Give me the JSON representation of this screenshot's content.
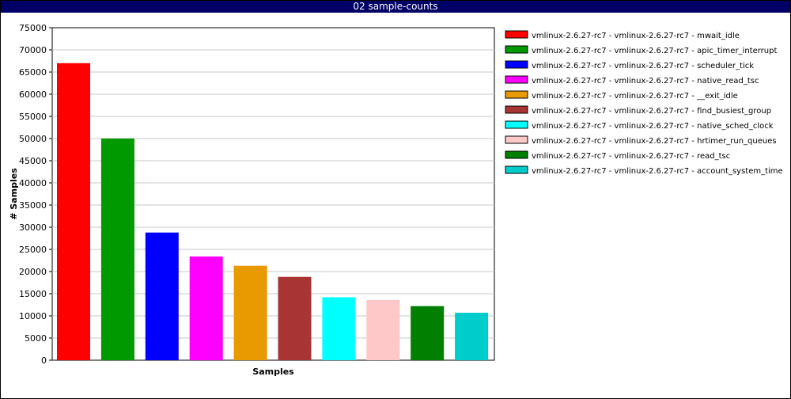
{
  "window": {
    "title": "02 sample-counts"
  },
  "chart_data": {
    "type": "bar",
    "xlabel": "Samples",
    "ylabel": "# Samples",
    "ylim": [
      0,
      75000
    ],
    "yticks": [
      0,
      5000,
      10000,
      15000,
      20000,
      25000,
      30000,
      35000,
      40000,
      45000,
      50000,
      55000,
      60000,
      65000,
      70000,
      75000
    ],
    "grid": true,
    "legend_position": "right",
    "series": [
      {
        "name": "vmlinux-2.6.27-rc7 - vmlinux-2.6.27-rc7 - mwait_idle",
        "value": 67000,
        "color": "#ff0000"
      },
      {
        "name": "vmlinux-2.6.27-rc7 - vmlinux-2.6.27-rc7 - apic_timer_interrupt",
        "value": 50000,
        "color": "#009900"
      },
      {
        "name": "vmlinux-2.6.27-rc7 - vmlinux-2.6.27-rc7 - scheduler_tick",
        "value": 28800,
        "color": "#0000ff"
      },
      {
        "name": "vmlinux-2.6.27-rc7 - vmlinux-2.6.27-rc7 - native_read_tsc",
        "value": 23400,
        "color": "#ff00ff"
      },
      {
        "name": "vmlinux-2.6.27-rc7 - vmlinux-2.6.27-rc7 - __exit_idle",
        "value": 21300,
        "color": "#e89a00"
      },
      {
        "name": "vmlinux-2.6.27-rc7 - vmlinux-2.6.27-rc7 - find_busiest_group",
        "value": 18800,
        "color": "#a83434"
      },
      {
        "name": "vmlinux-2.6.27-rc7 - vmlinux-2.6.27-rc7 - native_sched_clock",
        "value": 14200,
        "color": "#00ffff"
      },
      {
        "name": "vmlinux-2.6.27-rc7 - vmlinux-2.6.27-rc7 - hrtimer_run_queues",
        "value": 13600,
        "color": "#ffc8c8"
      },
      {
        "name": "vmlinux-2.6.27-rc7 - vmlinux-2.6.27-rc7 - read_tsc",
        "value": 12200,
        "color": "#007f00"
      },
      {
        "name": "vmlinux-2.6.27-rc7 - vmlinux-2.6.27-rc7 - account_system_time",
        "value": 10700,
        "color": "#00cccc"
      }
    ]
  }
}
